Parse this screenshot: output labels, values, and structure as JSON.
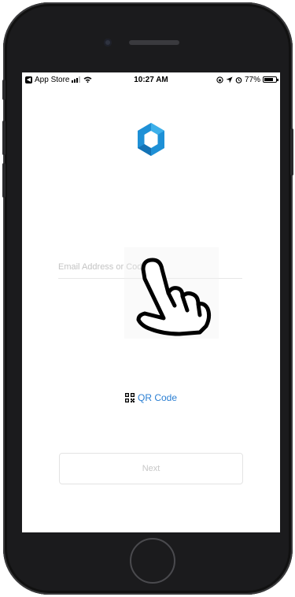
{
  "status_bar": {
    "carrier": "App Store",
    "time": "10:27 AM",
    "battery": "77%",
    "battery_level": 0.77
  },
  "login": {
    "email_placeholder": "Email Address or Code",
    "qr_label": "QR Code",
    "next_label": "Next"
  },
  "colors": {
    "accent": "#2b7fd3",
    "logo_blue": "#1e90d6",
    "phone_body": "#1b1b1d"
  },
  "icons": [
    "back-icon",
    "signal-icon",
    "wifi-icon",
    "location-icon",
    "alarm-icon",
    "battery-icon",
    "app-logo-icon",
    "qr-code-icon",
    "pointer-hand-icon"
  ]
}
